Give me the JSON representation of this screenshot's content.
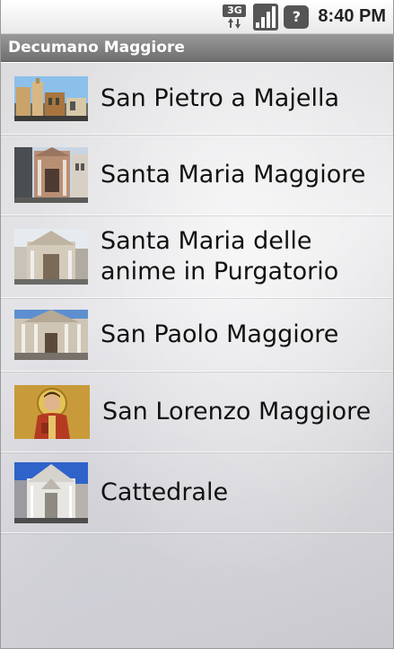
{
  "status_bar": {
    "network": "3G",
    "time": "8:40 PM",
    "icons": [
      "3g-data-icon",
      "signal-strength-icon",
      "battery-icon"
    ]
  },
  "title_bar": {
    "title": "Decumano Maggiore"
  },
  "list": {
    "items": [
      {
        "label": "San Pietro a Majella",
        "thumbnail": "church-photo-icon"
      },
      {
        "label": "Santa Maria Maggiore",
        "thumbnail": "church-photo-icon"
      },
      {
        "label": "Santa Maria delle anime in Purgatorio",
        "thumbnail": "church-photo-icon"
      },
      {
        "label": "San Paolo Maggiore",
        "thumbnail": "church-photo-icon"
      },
      {
        "label": "San Lorenzo Maggiore",
        "thumbnail": "saint-icon-painting"
      },
      {
        "label": "Cattedrale",
        "thumbnail": "cathedral-photo-icon"
      }
    ]
  },
  "colors": {
    "title_bar": "#7f7f7f",
    "text": "#111111",
    "background": "#e2e2e5"
  }
}
